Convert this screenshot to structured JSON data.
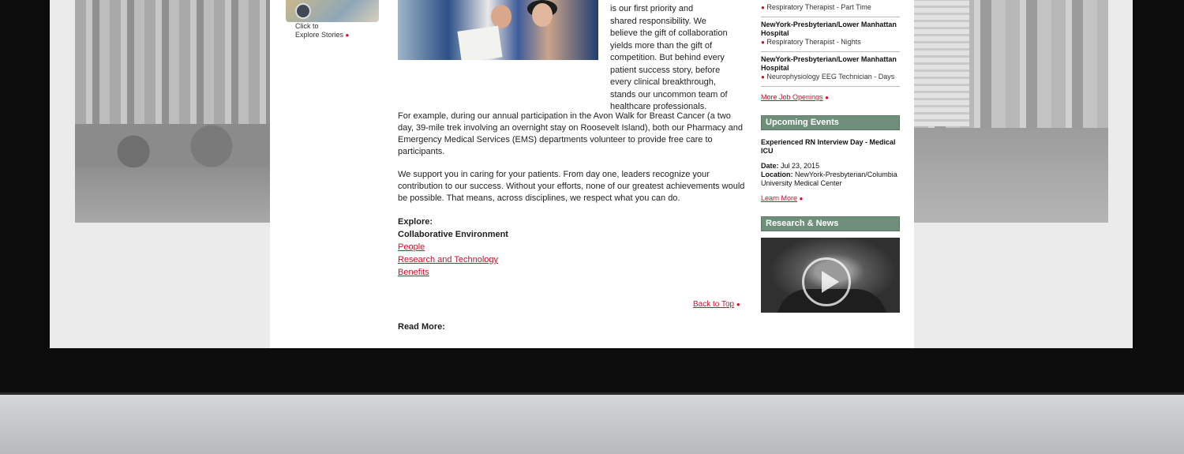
{
  "explore_card": {
    "line1": "Click to",
    "line2": "Explore Stories",
    "bullet": "●"
  },
  "intro_lines": [
    "is our first priority and",
    "shared responsibility. We",
    "believe the gift of collaboration",
    "yields more than the gift of",
    "competition. But behind every",
    "patient success story, before",
    "every clinical breakthrough,",
    "stands our uncommon team of",
    "healthcare professionals."
  ],
  "paragraphs": [
    "For example, during our annual participation in the Avon Walk for Breast Cancer (a two day, 39-mile trek involving an overnight stay on Roosevelt Island), both our Pharmacy and Emergency Medical Services (EMS) departments volunteer to provide free care to participants.",
    "We support you in caring for your patients. From day one, leaders recognize your contribution to our success. Without your efforts, none of our greatest achievements would be possible. That means, across disciplines, we respect what you can do."
  ],
  "explore": {
    "heading": "Explore:",
    "current": "Collaborative Environment",
    "links": [
      "People",
      "Research and Technology",
      "Benefits"
    ]
  },
  "back_to_top": "Back to Top",
  "read_more": "Read More:",
  "jobs": [
    {
      "location": "",
      "title": "Respiratory Therapist - Part Time"
    },
    {
      "location": "NewYork-Presbyterian/Lower Manhattan Hospital",
      "title": "Respiratory Therapist - Nights"
    },
    {
      "location": "NewYork-Presbyterian/Lower Manhattan Hospital",
      "title": "Neurophysiology EEG Technician - Days"
    }
  ],
  "more_jobs": "More Job Openings",
  "upcoming": {
    "heading": "Upcoming Events",
    "event_title": "Experienced RN Interview Day - Medical ICU",
    "date_label": "Date:",
    "date": "Jul 23, 2015",
    "location_label": "Location:",
    "location": "NewYork-Presbyterian/Columbia University Medical Center",
    "learn_more": "Learn More"
  },
  "research": {
    "heading": "Research & News"
  },
  "colors": {
    "accent_red": "#c8102e",
    "section_green": "#6f8f7a"
  }
}
